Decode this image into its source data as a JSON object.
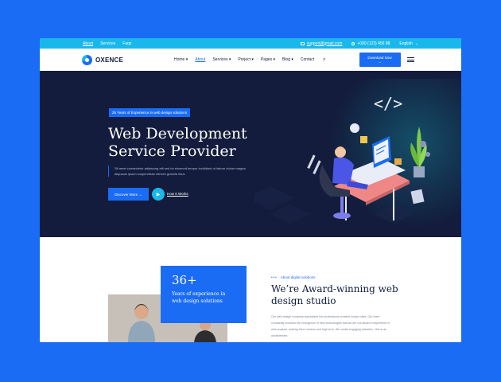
{
  "topbar": {
    "links": [
      "About",
      "Services",
      "Faqs"
    ],
    "email": "support@gmail.com",
    "phone": "+000 (123) 456 88",
    "language": "English"
  },
  "nav": {
    "brand": "OXENCE",
    "items": [
      "Home",
      "About",
      "Services",
      "Porject",
      "Pages",
      "Blog",
      "Contact"
    ],
    "cta": "Download Now"
  },
  "hero": {
    "badge": "25 Years of Experience in web design solutions",
    "title": "Web Development Service Provider",
    "description": "Sit amet consectetur adipiscing elit sed do eiusmod tempor incididunt ut labore dolore magna aliquauis ipsum suspendisse ultrices gravida risus",
    "primary_button": "Discover More",
    "secondary_link": "How It Works"
  },
  "about": {
    "stat_number": "36+",
    "stat_label": "Years of experience in web design solutions",
    "tag": "About digital solutions",
    "heading": "We’re Award-winning web design studio",
    "paragraph": "Our web design company specializes the professional creative unique sites. Our team constantly monitors the emergence of new technologies that we are not afraid to implement in web projects, making them modern and high-tech. We create engaging websites - this is an achievement"
  },
  "colors": {
    "page_bg": "#1a6cf5",
    "topbar": "#1ab8ea",
    "hero_bg": "#131c3c",
    "accent": "#1a6cf5"
  }
}
